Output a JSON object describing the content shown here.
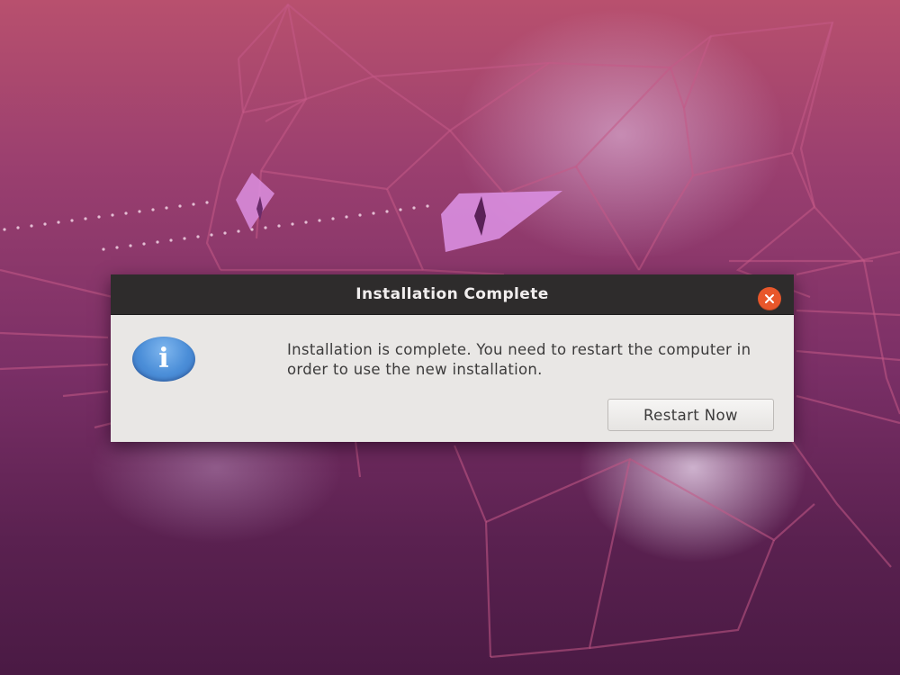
{
  "dialog": {
    "title": "Installation Complete",
    "icon": "info-icon",
    "icon_glyph": "i",
    "message": "Installation is complete. You need to restart the computer in order to use the new installation.",
    "restart_button_label": "Restart Now",
    "close_icon_glyph": "×"
  },
  "colors": {
    "titlebar": "#2e2c2c",
    "close_button": "#e8572b",
    "dialog_body": "#e9e7e5",
    "info_icon": "#4b8ed8"
  }
}
